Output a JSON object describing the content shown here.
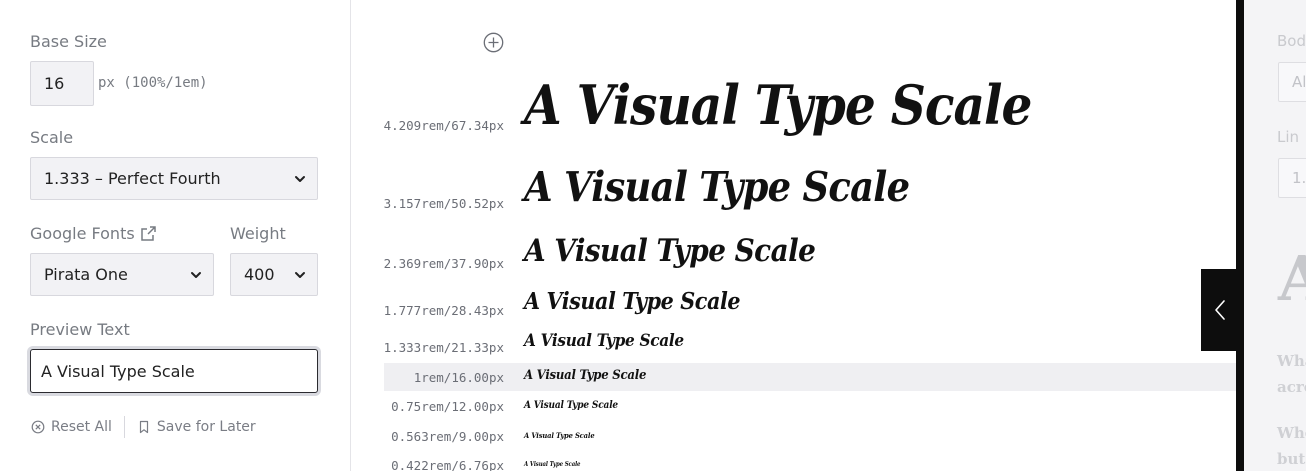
{
  "controls": {
    "base_size_label": "Base Size",
    "base_size_value": "16",
    "base_size_unit": "px (100%/1em)",
    "scale_label": "Scale",
    "scale_value": "1.333 – Perfect Fourth",
    "google_fonts_label": "Google Fonts",
    "font_value": "Pirata One",
    "weight_label": "Weight",
    "weight_value": "400",
    "preview_text_label": "Preview Text",
    "preview_text_value": "A Visual Type Scale",
    "reset_label": "Reset All",
    "save_label": "Save for Later"
  },
  "scale": {
    "sample_text": "A Visual Type Scale",
    "rows": [
      {
        "label": "4.209rem/67.34px"
      },
      {
        "label": "3.157rem/50.52px"
      },
      {
        "label": "2.369rem/37.90px"
      },
      {
        "label": "1.777rem/28.43px"
      },
      {
        "label": "1.333rem/21.33px"
      },
      {
        "label": "1rem/16.00px"
      },
      {
        "label": "0.75rem/12.00px"
      },
      {
        "label": "0.563rem/9.00px"
      },
      {
        "label": "0.422rem/6.76px"
      }
    ]
  },
  "right_panel": {
    "body_label": "Bod",
    "body_value": "Al",
    "line_label": "Lin",
    "line_value": "1.",
    "big_letter": "A",
    "para1_line1": "Wha",
    "para1_line2": "acro",
    "para2_line1": "Whe",
    "para2_line2": "but"
  },
  "icons": {
    "add": "plus-circle-icon",
    "external": "external-link-icon",
    "reset": "x-circle-icon",
    "save": "bookmark-icon",
    "toggle": "chevron-left-icon",
    "select": "chevron-down-icon"
  },
  "colors": {
    "accent_dark": "#0d0d0d",
    "highlight_row": "#efeff2",
    "field_bg": "#f2f2f5",
    "label_gray": "#777b82"
  }
}
